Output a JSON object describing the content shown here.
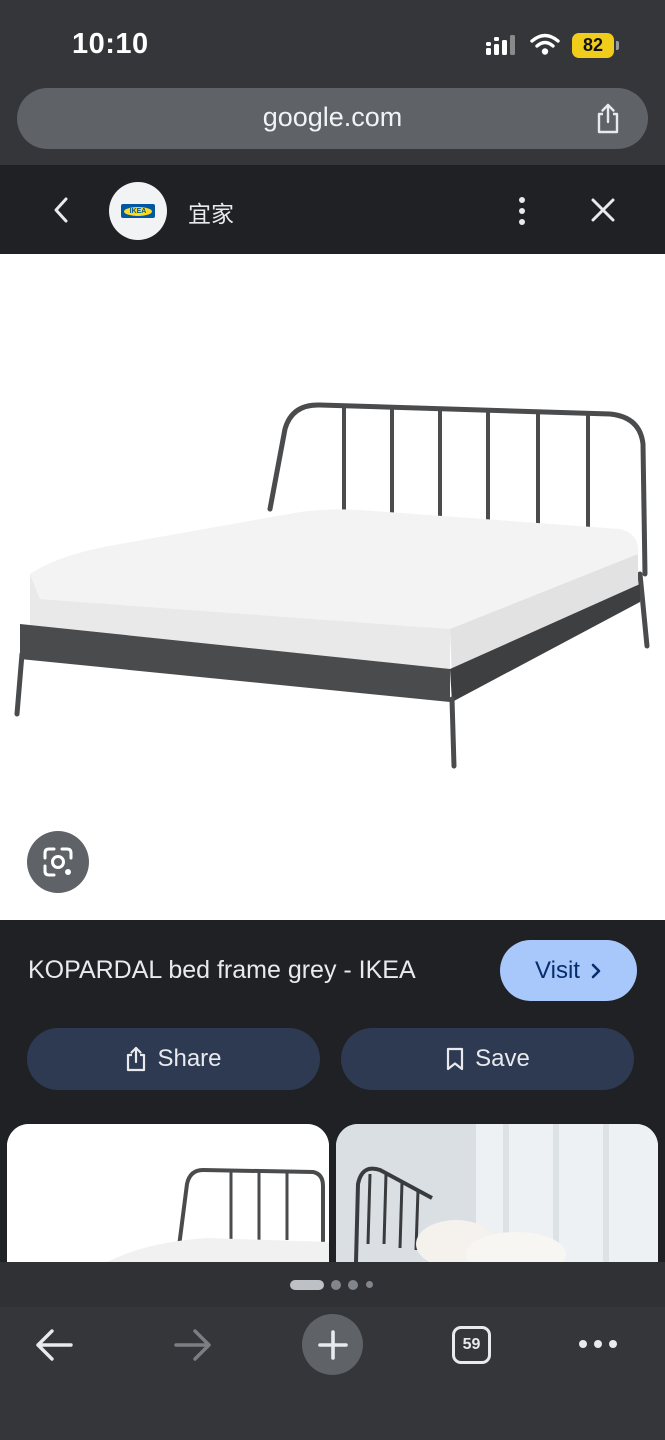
{
  "status_bar": {
    "time": "10:10",
    "battery": "82"
  },
  "url_bar": {
    "domain": "google.com"
  },
  "site_header": {
    "site_name": "宜家",
    "logo_text": "IKEA"
  },
  "result": {
    "title": "KOPARDAL bed frame grey - IKEA",
    "visit_label": "Visit",
    "share_label": "Share",
    "save_label": "Save"
  },
  "toolbar": {
    "tab_count": "59"
  },
  "pager": {
    "current_page": 1,
    "total_pages": 4
  },
  "colors": {
    "chrome_bar": "#35363a",
    "background": "#202124",
    "visit_button": "#a8c7fa",
    "action_button": "#2d3a52",
    "battery": "#f0cd1a",
    "bed_frame": "#4a4b4d"
  },
  "icons": [
    "signal-icon",
    "wifi-icon",
    "share-icon",
    "chevron-left-icon",
    "more-vert-icon",
    "close-icon",
    "lens-icon",
    "chevron-right-icon",
    "bookmark-icon",
    "arrow-back-icon",
    "arrow-forward-icon",
    "plus-icon",
    "tab-switcher-icon",
    "more-horiz-icon"
  ]
}
